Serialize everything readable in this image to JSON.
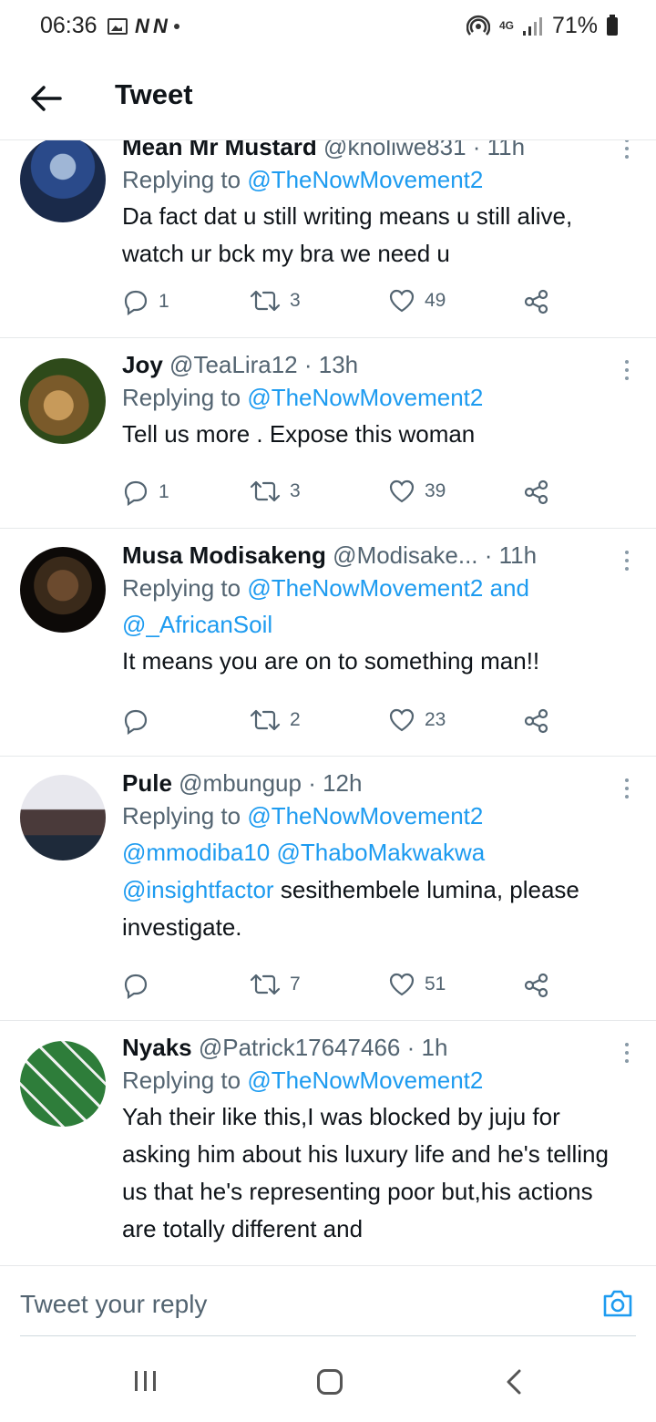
{
  "status_bar": {
    "time": "06:36",
    "battery": "71%",
    "network": "4G"
  },
  "header": {
    "title": "Tweet"
  },
  "tweets": [
    {
      "name": "Mean Mr Mustard",
      "handle": "@knoliwe831",
      "time": "· 11h",
      "reply_prefix": "Replying to",
      "reply_mentions": "@TheNowMovement2",
      "text": "Da fact dat u still writing means u still alive, watch ur bck my bra we need u",
      "replies": "1",
      "retweets": "3",
      "likes": "49"
    },
    {
      "name": "Joy",
      "handle": "@TeaLira12",
      "time": "· 13h",
      "reply_prefix": "Replying to",
      "reply_mentions": "@TheNowMovement2",
      "text": "Tell us more . Expose this woman",
      "replies": "1",
      "retweets": "3",
      "likes": "39"
    },
    {
      "name": "Musa Modisakeng",
      "handle": "@Modisake...",
      "time": "· 11h",
      "reply_prefix": "Replying to",
      "reply_mentions": "@TheNowMovement2 and @_AfricanSoil",
      "text": "It means you are on to something man!!",
      "replies": "",
      "retweets": "2",
      "likes": "23"
    },
    {
      "name": "Pule",
      "handle": "@mbungup",
      "time": "· 12h",
      "reply_prefix": "Replying to",
      "reply_mentions": "@TheNowMovement2",
      "text_mentions": "@mmodiba10 @ThaboMakwakwa @insightfactor",
      "text": "sesithembele lumina, please investigate.",
      "replies": "",
      "retweets": "7",
      "likes": "51"
    },
    {
      "name": "Nyaks",
      "handle": "@Patrick17647466",
      "time": "· 1h",
      "reply_prefix": "Replying to",
      "reply_mentions": "@TheNowMovement2",
      "text": "Yah their like this,I was blocked by juju for asking him about his luxury life and he's telling us that he's representing poor but,his actions are totally different and"
    }
  ],
  "reply_bar": {
    "placeholder": "Tweet your reply"
  },
  "icons": {
    "back": "arrow-left-icon",
    "more": "more-vertical-icon",
    "reply": "comment-icon",
    "retweet": "retweet-icon",
    "like": "heart-icon",
    "share": "share-icon",
    "camera": "camera-icon"
  },
  "colors": {
    "accent": "#1d9bf0",
    "text": "#0f1419",
    "secondary": "#536471"
  }
}
